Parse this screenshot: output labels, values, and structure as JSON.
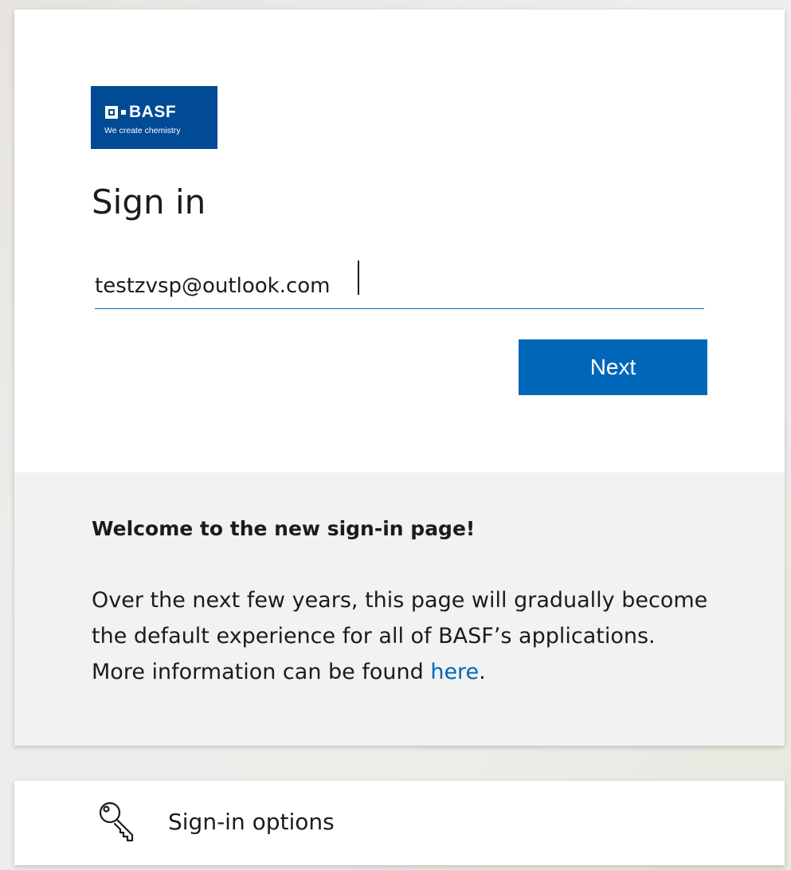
{
  "logo": {
    "brand": "BASF",
    "tagline": "We create chemistry",
    "background_color": "#004a96"
  },
  "signin": {
    "title": "Sign in",
    "email_value": "testzvsp@outlook.com",
    "next_label": "Next",
    "accent_color": "#0067b8"
  },
  "info": {
    "heading": "Welcome to the new sign-in page!",
    "body_text": "Over the next few years, this page will gradually become the default experience for all of BASF’s applications. More information can be found ",
    "link_text": "here",
    "trailing_text": "."
  },
  "options": {
    "icon": "key-icon",
    "label": "Sign-in options"
  }
}
